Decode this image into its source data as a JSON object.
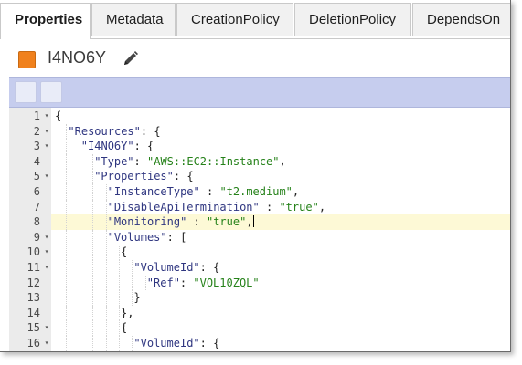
{
  "tabs": [
    {
      "label": "Properties",
      "active": true
    },
    {
      "label": "Metadata",
      "active": false
    },
    {
      "label": "CreationPolicy",
      "active": false
    },
    {
      "label": "DeletionPolicy",
      "active": false
    },
    {
      "label": "DependsOn",
      "active": false
    }
  ],
  "resource": {
    "name": "I4NO6Y",
    "color": "#f0811d",
    "edit_icon": "pencil-icon"
  },
  "editor": {
    "highlighted_line": 8,
    "lines": [
      {
        "n": "1",
        "fold": true,
        "tokens": [
          {
            "t": "{",
            "c": "p"
          }
        ]
      },
      {
        "n": "2",
        "fold": true,
        "tokens": [
          {
            "t": "\"Resources\"",
            "c": "k"
          },
          {
            "t": ": {",
            "c": "p"
          }
        ]
      },
      {
        "n": "3",
        "fold": true,
        "tokens": [
          {
            "t": "\"I4NO6Y\"",
            "c": "k"
          },
          {
            "t": ": {",
            "c": "p"
          }
        ]
      },
      {
        "n": "4",
        "fold": false,
        "tokens": [
          {
            "t": "\"Type\"",
            "c": "k"
          },
          {
            "t": ": ",
            "c": "p"
          },
          {
            "t": "\"AWS::EC2::Instance\"",
            "c": "s"
          },
          {
            "t": ",",
            "c": "p"
          }
        ]
      },
      {
        "n": "5",
        "fold": true,
        "tokens": [
          {
            "t": "\"Properties\"",
            "c": "k"
          },
          {
            "t": ": {",
            "c": "p"
          }
        ]
      },
      {
        "n": "6",
        "fold": false,
        "tokens": [
          {
            "t": "\"InstanceType\"",
            "c": "k"
          },
          {
            "t": " : ",
            "c": "p"
          },
          {
            "t": "\"t2.medium\"",
            "c": "s"
          },
          {
            "t": ",",
            "c": "p"
          }
        ]
      },
      {
        "n": "7",
        "fold": false,
        "tokens": [
          {
            "t": "\"DisableApiTermination\"",
            "c": "k"
          },
          {
            "t": " : ",
            "c": "p"
          },
          {
            "t": "\"true\"",
            "c": "s"
          },
          {
            "t": ",",
            "c": "p"
          }
        ]
      },
      {
        "n": "8",
        "fold": false,
        "tokens": [
          {
            "t": "\"Monitoring\"",
            "c": "k"
          },
          {
            "t": " : ",
            "c": "p"
          },
          {
            "t": "\"true\"",
            "c": "s"
          },
          {
            "t": ",",
            "c": "p"
          }
        ]
      },
      {
        "n": "9",
        "fold": true,
        "tokens": [
          {
            "t": "\"Volumes\"",
            "c": "k"
          },
          {
            "t": ": [",
            "c": "p"
          }
        ]
      },
      {
        "n": "10",
        "fold": true,
        "tokens": [
          {
            "t": "{",
            "c": "p"
          }
        ]
      },
      {
        "n": "11",
        "fold": true,
        "tokens": [
          {
            "t": "\"VolumeId\"",
            "c": "k"
          },
          {
            "t": ": {",
            "c": "p"
          }
        ]
      },
      {
        "n": "12",
        "fold": false,
        "tokens": [
          {
            "t": "\"Ref\"",
            "c": "k"
          },
          {
            "t": ": ",
            "c": "p"
          },
          {
            "t": "\"VOL10ZQL\"",
            "c": "s"
          }
        ]
      },
      {
        "n": "13",
        "fold": false,
        "tokens": [
          {
            "t": "}",
            "c": "p"
          }
        ]
      },
      {
        "n": "14",
        "fold": false,
        "tokens": [
          {
            "t": "},",
            "c": "p"
          }
        ]
      },
      {
        "n": "15",
        "fold": true,
        "tokens": [
          {
            "t": "{",
            "c": "p"
          }
        ]
      },
      {
        "n": "16",
        "fold": true,
        "tokens": [
          {
            "t": "\"VolumeId\"",
            "c": "k"
          },
          {
            "t": ": {",
            "c": "p"
          }
        ]
      }
    ]
  }
}
